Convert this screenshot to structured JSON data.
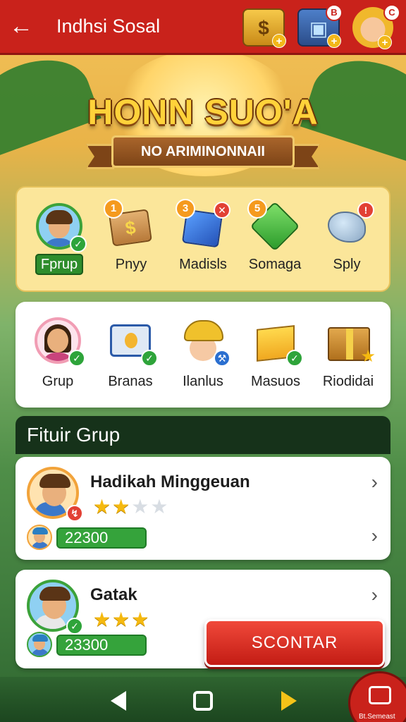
{
  "header": {
    "title": "Indhsi Sosal",
    "top_icons": [
      {
        "name": "coin-bag-icon",
        "glyph": "$"
      },
      {
        "name": "tv-shop-icon",
        "badge": "B"
      },
      {
        "name": "worker-avatar-icon",
        "badge": "C"
      }
    ]
  },
  "banner": {
    "title": "HONN SUO'A",
    "subtitle": "NO ARIMINONNAII"
  },
  "row1": [
    {
      "label": "Fprup",
      "icon": "avatar",
      "selected": true
    },
    {
      "label": "Pnyy",
      "icon": "money-bag-icon",
      "badge": "1"
    },
    {
      "label": "Madisls",
      "icon": "blue-cube-icon",
      "badge": "3"
    },
    {
      "label": "Somaga",
      "icon": "green-gem-icon",
      "badge": "5"
    },
    {
      "label": "Sply",
      "icon": "rock-icon"
    }
  ],
  "row2": [
    {
      "label": "Grup",
      "icon": "avatar"
    },
    {
      "label": "Branas",
      "icon": "screen-icon"
    },
    {
      "label": "Ilanlus",
      "icon": "hat-avatar-icon"
    },
    {
      "label": "Masuos",
      "icon": "yellow-box-icon"
    },
    {
      "label": "Riodidai",
      "icon": "gift-box-icon"
    }
  ],
  "section": {
    "title": "Fituir Grup"
  },
  "groups": [
    {
      "name": "Hadikah Minggeuan",
      "stars_filled": 2,
      "stars_total": 4,
      "score": "22300"
    },
    {
      "name": "Gatak",
      "stars_filled": 3,
      "stars_total": 3,
      "score": "23300"
    }
  ],
  "cta": {
    "label": "SCONTAR"
  },
  "corner_button": {
    "label": "Bt.Semeast"
  },
  "colors": {
    "topbar": "#c9221b",
    "accent_green": "#35a33b",
    "star": "#f5b90f"
  }
}
